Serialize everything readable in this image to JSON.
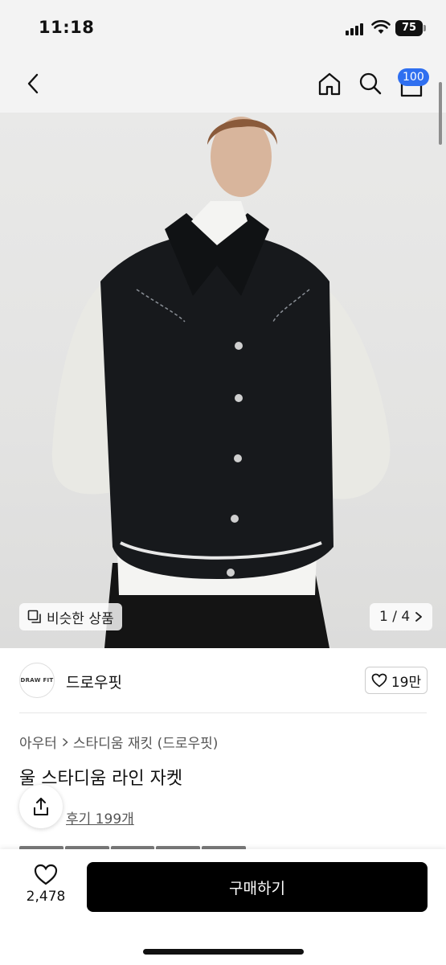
{
  "status": {
    "time": "11:18",
    "battery": "75"
  },
  "nav": {
    "cart_count": "100"
  },
  "gallery": {
    "similar_label": "비슷한 상품",
    "counter": "1 / 4"
  },
  "brand": {
    "logo_text": "DRAW FIT",
    "name": "드로우핏",
    "likes": "19만"
  },
  "product": {
    "breadcrumb": [
      "아우터",
      "스타디움 재킷 (드로우핏)"
    ],
    "title": "울 스타디움 라인 자켓",
    "reviews": "후기 199개"
  },
  "bottom": {
    "wish_count": "2,478",
    "buy_label": "구매하기"
  },
  "colors": {
    "accent": "#2f6ff0",
    "primary_button": "#000000"
  }
}
